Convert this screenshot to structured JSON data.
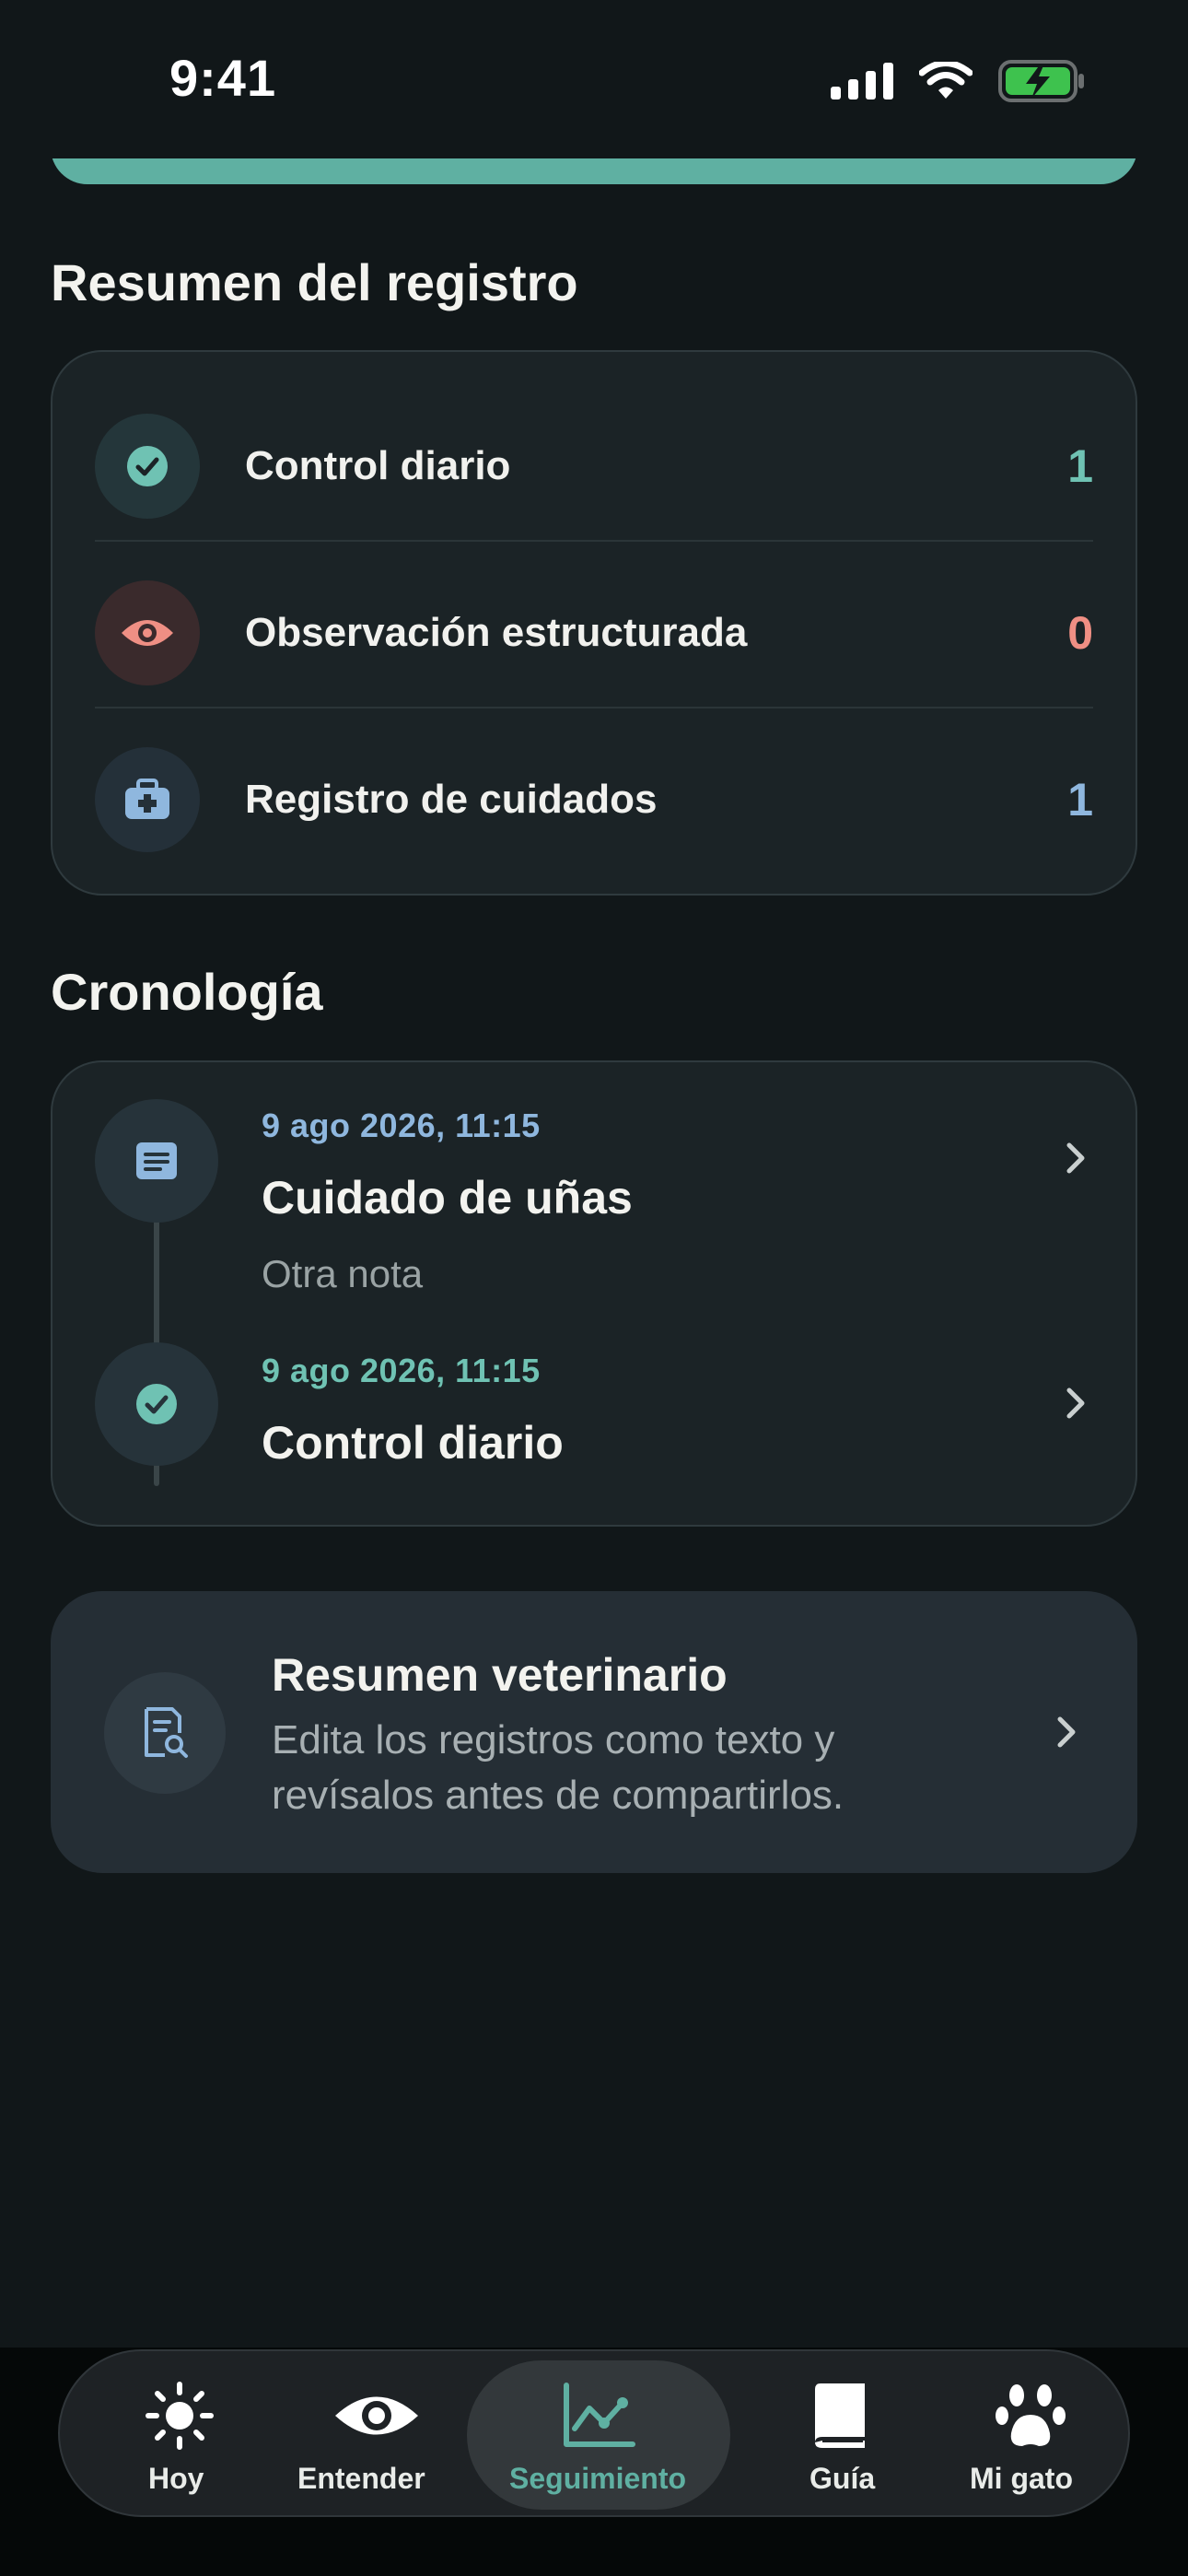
{
  "status_bar": {
    "time": "9:41"
  },
  "summary": {
    "title": "Resumen del registro",
    "rows": [
      {
        "label": "Control diario",
        "count": "1",
        "icon": "check-circle-icon",
        "color": "#6fc2b3"
      },
      {
        "label": "Observación estructurada",
        "count": "0",
        "icon": "eye-icon",
        "color": "#ef8f84"
      },
      {
        "label": "Registro de cuidados",
        "count": "1",
        "icon": "medical-kit-icon",
        "color": "#8fb7de"
      }
    ]
  },
  "timeline": {
    "title": "Cronología",
    "items": [
      {
        "date": "9 ago 2026, 11:15",
        "title": "Cuidado de uñas",
        "note": "Otra nota",
        "icon": "note-icon"
      },
      {
        "date": "9 ago 2026, 11:15",
        "title": "Control diario",
        "icon": "check-circle-icon"
      }
    ]
  },
  "vet_summary": {
    "title": "Resumen veterinario",
    "description": "Edita los registros como texto y revísalos antes de compartirlos.",
    "icon": "document-search-icon"
  },
  "tabbar": {
    "active": "Seguimiento",
    "accent": "#5fb0a2",
    "tabs": [
      {
        "label": "Hoy",
        "icon": "sun-icon"
      },
      {
        "label": "Entender",
        "icon": "eye-icon"
      },
      {
        "label": "Seguimiento",
        "icon": "chart-icon"
      },
      {
        "label": "Guía",
        "icon": "book-icon"
      },
      {
        "label": "Mi gato",
        "icon": "paw-icon"
      }
    ]
  }
}
